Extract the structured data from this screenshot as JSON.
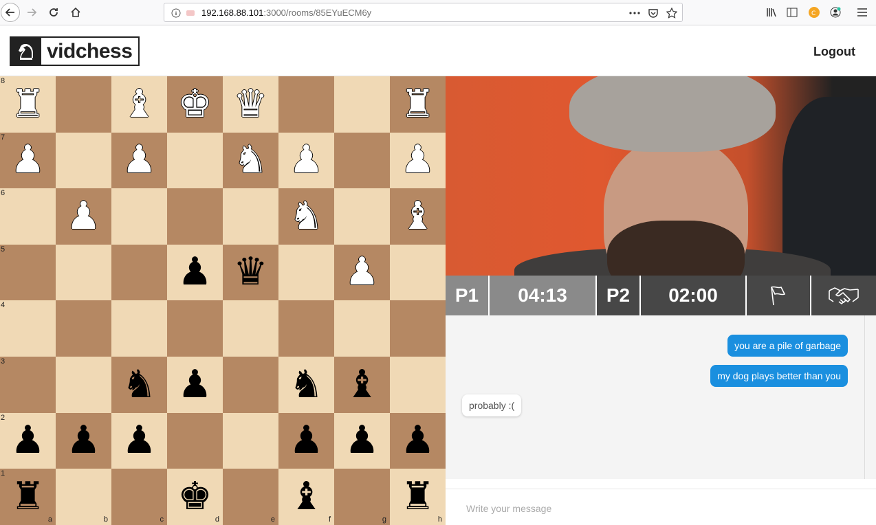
{
  "browser": {
    "url_host": "192.168.88.101",
    "url_path": ":3000/rooms/85EYuECM6y"
  },
  "header": {
    "logo_text": "vidchess",
    "logout_label": "Logout"
  },
  "board": {
    "ranks": [
      "8",
      "7",
      "6",
      "5",
      "4",
      "3",
      "2",
      "1"
    ],
    "files": [
      "a",
      "b",
      "c",
      "d",
      "e",
      "f",
      "g",
      "h"
    ],
    "pieces": {
      "a8": "♜w",
      "c8": "♝w",
      "d8": "♚w",
      "e8": "♛w",
      "h8": "♜w",
      "a7": "♟w",
      "c7": "♟w",
      "e7": "♞w",
      "f7": "♟w",
      "h7": "♟w",
      "b6": "♟w",
      "f6": "♞w",
      "h6": "♝w",
      "d5": "♟b",
      "e5": "♛b",
      "g5": "♟w",
      "c3": "♞b",
      "d3": "♟b",
      "f3": "♞b",
      "g3": "♝b",
      "a2": "♟b",
      "b2": "♟b",
      "c2": "♟b",
      "f2": "♟b",
      "g2": "♟b",
      "h2": "♟b",
      "a1": "♜b",
      "d1": "♚b",
      "f1": "♝b",
      "h1": "♜b"
    }
  },
  "timers": {
    "p1_label": "P1",
    "p1_time": "04:13",
    "p2_label": "P2",
    "p2_time": "02:00"
  },
  "chat": {
    "messages": [
      {
        "from": "me",
        "text": "you are a pile of garbage"
      },
      {
        "from": "me",
        "text": "my dog plays better than you"
      },
      {
        "from": "them",
        "text": "probably :("
      }
    ],
    "placeholder": "Write your message"
  },
  "colors": {
    "light_square": "#f0d9b5",
    "dark_square": "#b58863",
    "my_bubble": "#1a8fdf"
  }
}
